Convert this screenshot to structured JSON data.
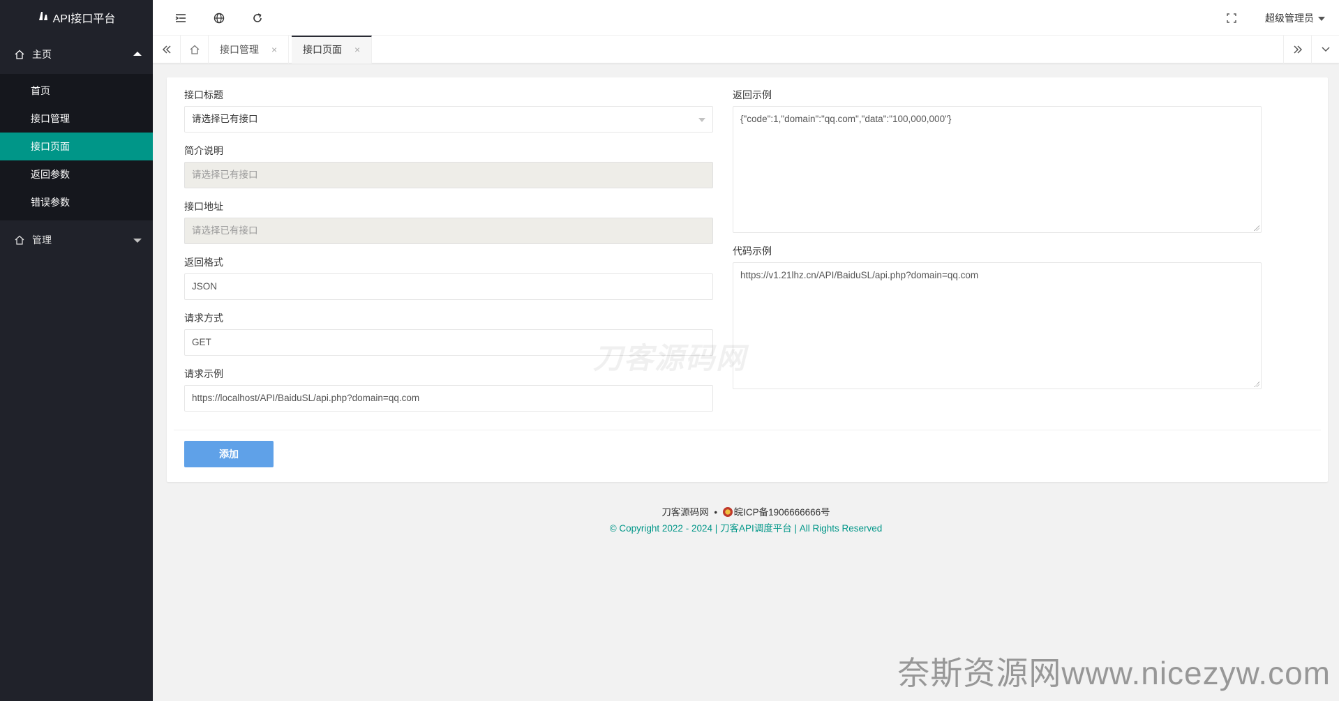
{
  "app": {
    "title": "API接口平台"
  },
  "sidebar": {
    "groups": [
      {
        "label": "主页",
        "items": [
          {
            "label": "首页"
          },
          {
            "label": "接口管理"
          },
          {
            "label": "接口页面"
          },
          {
            "label": "返回参数"
          },
          {
            "label": "错误参数"
          }
        ]
      },
      {
        "label": "管理"
      }
    ],
    "active_item": "接口页面"
  },
  "header": {
    "user_name": "超级管理员"
  },
  "tabs": [
    {
      "label": "接口管理",
      "close": "×"
    },
    {
      "label": "接口页面",
      "close": "×"
    }
  ],
  "form": {
    "title": {
      "label": "接口标题",
      "value": "请选择已有接口"
    },
    "intro": {
      "label": "简介说明",
      "value": "请选择已有接口"
    },
    "address": {
      "label": "接口地址",
      "value": "请选择已有接口"
    },
    "format": {
      "label": "返回格式",
      "value": "JSON"
    },
    "method": {
      "label": "请求方式",
      "value": "GET"
    },
    "request_example": {
      "label": "请求示例",
      "value": "https://localhost/API/BaiduSL/api.php?domain=qq.com"
    },
    "return_example": {
      "label": "返回示例",
      "value": "{\"code\":1,\"domain\":\"qq.com\",\"data\":\"100,000,000\"}"
    },
    "code_example": {
      "label": "代码示例",
      "value": "https://v1.21lhz.cn/API/BaiduSL/api.php?domain=qq.com"
    },
    "submit_label": "添加"
  },
  "footer": {
    "site_name": "刀客源码网",
    "separator": "•",
    "icp": "皖ICP备1906666666号",
    "copyright": "© Copyright 2022 - 2024 | 刀客API调度平台 | All Rights Reserved"
  },
  "watermarks": {
    "center": "刀客源码网",
    "corner": "奈斯资源网www.nicezyw.com"
  },
  "colors": {
    "sidebar_bg": "#20222a",
    "sidebar_sub_bg": "#15171d",
    "active_green": "#009688",
    "button_blue": "#5fa1e8"
  }
}
